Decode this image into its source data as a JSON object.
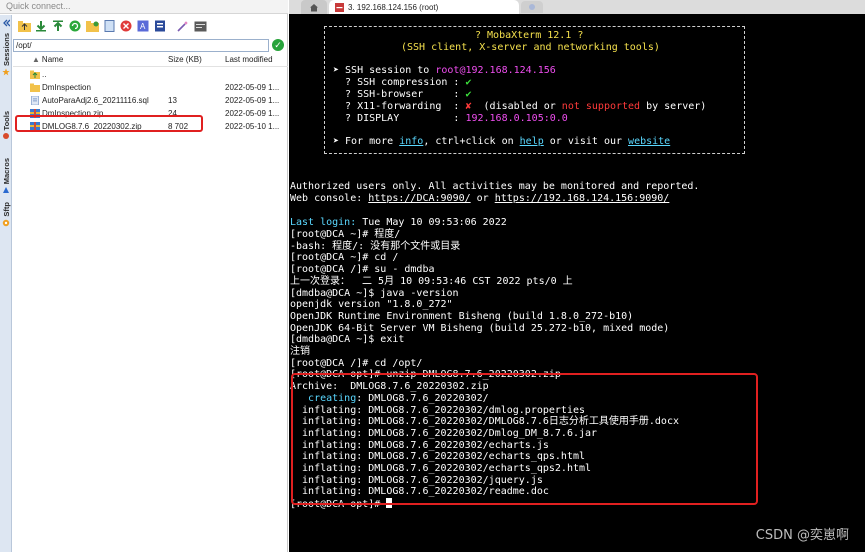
{
  "left": {
    "quick_connect_placeholder": "Quick connect...",
    "vertical_tabs": [
      "Sessions",
      "Tools",
      "Macros",
      "Sftp"
    ],
    "path": "/opt/",
    "columns": {
      "name": "Name",
      "size": "Size (KB)",
      "modified": "Last modified"
    },
    "files": [
      {
        "name": "..",
        "size": "",
        "modified": "",
        "icon": "parent-folder-icon"
      },
      {
        "name": "DmInspection",
        "size": "",
        "modified": "2022-05-09 1...",
        "icon": "folder-icon"
      },
      {
        "name": "AutoParaAdj2.6_20211116.sql",
        "size": "13",
        "modified": "2022-05-09 1...",
        "icon": "file-icon"
      },
      {
        "name": "DmInspection.zip",
        "size": "24",
        "modified": "2022-05-09 1...",
        "icon": "zip-icon"
      },
      {
        "name": "DMLOG8.7.6_20220302.zip",
        "size": "8 702",
        "modified": "2022-05-10 1...",
        "icon": "zip-icon"
      }
    ]
  },
  "right": {
    "tab_title": "3. 192.168.124.156 (root)",
    "banner": {
      "title": "? MobaXterm 12.1 ?",
      "subtitle": "(SSH client, X-server and networking tools)",
      "session_prefix": "➤ SSH session to ",
      "session_host": "root@192.168.124.156",
      "compression_label": "  ? SSH compression : ",
      "compression_value": "✔",
      "browser_label": "  ? SSH-browser     : ",
      "browser_value": "✔",
      "x11_label": "  ? X11-forwarding  : ",
      "x11_value": "✘",
      "x11_note_a": "  (disabled or ",
      "x11_note_b": "not supported",
      "x11_note_c": " by server)",
      "display_label": "  ? DISPLAY         : ",
      "display_value": "192.168.0.105:0.0",
      "more_a": "➤ For more ",
      "more_info": "info",
      "more_b": ", ctrl+click on ",
      "more_help": "help",
      "more_c": " or visit our ",
      "more_site": "website"
    },
    "auth_line": "Authorized users only. All activities may be monitored and reported.",
    "web_console_a": "Web console: ",
    "web_console_b": "https://DCA:9090/",
    "web_console_c": " or ",
    "web_console_d": "https://192.168.124.156:9090/",
    "last_login_label": "Last login:",
    "last_login_value": " Tue May 10 09:53:06 2022",
    "lines": [
      "[root@DCA ~]# 程度/",
      "-bash: 程度/: 没有那个文件或目录",
      "[root@DCA ~]# cd /",
      "[root@DCA /]# su - dmdba",
      "上一次登录：  二 5月 10 09:53:46 CST 2022 pts/0 上",
      "[dmdba@DCA ~]$ java -version",
      "openjdk version \"1.8.0_272\"",
      "OpenJDK Runtime Environment Bisheng (build 1.8.0_272-b10)",
      "OpenJDK 64-Bit Server VM Bisheng (build 25.272-b10, mixed mode)",
      "[dmdba@DCA ~]$ exit",
      "注销",
      "[root@DCA /]# cd /opt/",
      "[root@DCA opt]# unzip DMLOG8.7.6_20220302.zip",
      "Archive:  DMLOG8.7.6_20220302.zip"
    ],
    "creating_label": "   creating",
    "creating_value": ": DMLOG8.7.6_20220302/",
    "inflating": [
      "  inflating: DMLOG8.7.6_20220302/dmlog.properties",
      "  inflating: DMLOG8.7.6_20220302/DMLOG8.7.6日志分析工具使用手册.docx",
      "  inflating: DMLOG8.7.6_20220302/Dmlog_DM_8.7.6.jar",
      "  inflating: DMLOG8.7.6_20220302/echarts.js",
      "  inflating: DMLOG8.7.6_20220302/echarts_qps.html",
      "  inflating: DMLOG8.7.6_20220302/echarts_qps2.html",
      "  inflating: DMLOG8.7.6_20220302/jquery.js",
      "  inflating: DMLOG8.7.6_20220302/readme.doc"
    ],
    "prompt_final": "[root@DCA opt]# ",
    "watermark": "CSDN @奕崽啊"
  }
}
